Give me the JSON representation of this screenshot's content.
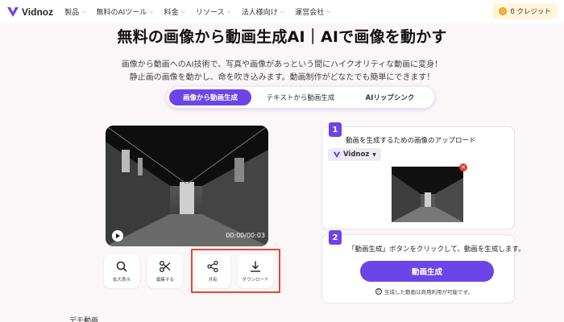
{
  "nav": {
    "logo": "Vidnoz",
    "items": [
      {
        "label": "製品"
      },
      {
        "label": "無料のAIツール"
      },
      {
        "label": "料金"
      },
      {
        "label": "リソース"
      },
      {
        "label": "法人様向け"
      },
      {
        "label": "運営会社"
      }
    ],
    "credit": "0 クレジット"
  },
  "hero": {
    "title": "無料の画像から動画生成AI｜AIで画像を動かす",
    "subtitle_line1": "画像から動画へのAI技術で、写真や画像があっという間にハイクオリティな動画に変身！",
    "subtitle_line2": "静止画の画像を動かし、命を吹き込みます。動画制作がどなたでも簡単にできます！"
  },
  "tabs": [
    {
      "label": "画像から動画生成",
      "active": true
    },
    {
      "label": "テキストから動画生成",
      "active": false
    },
    {
      "label": "AIリップシンク",
      "active": false
    }
  ],
  "player": {
    "time": "00:00/00:03"
  },
  "tools": [
    {
      "label": "拡大表示",
      "icon": "search-icon"
    },
    {
      "label": "編集する",
      "icon": "scissors-icon"
    },
    {
      "label": "共有",
      "icon": "share-icon"
    },
    {
      "label": "ダウンロード",
      "icon": "download-icon"
    }
  ],
  "demo_label": "デモ動画",
  "step1": {
    "number": "1",
    "text": "動画を生成するための画像のアップロード",
    "source": "Vidnoz"
  },
  "step2": {
    "number": "2",
    "text": "「動画生成」ボタンをクリックして、動画を生成します。",
    "button": "動画生成",
    "note": "生成した動画は商用利用が可能です。"
  },
  "colors": {
    "accent": "#6b45e8",
    "highlight": "#e04a2f",
    "background": "#fbf6f7"
  }
}
